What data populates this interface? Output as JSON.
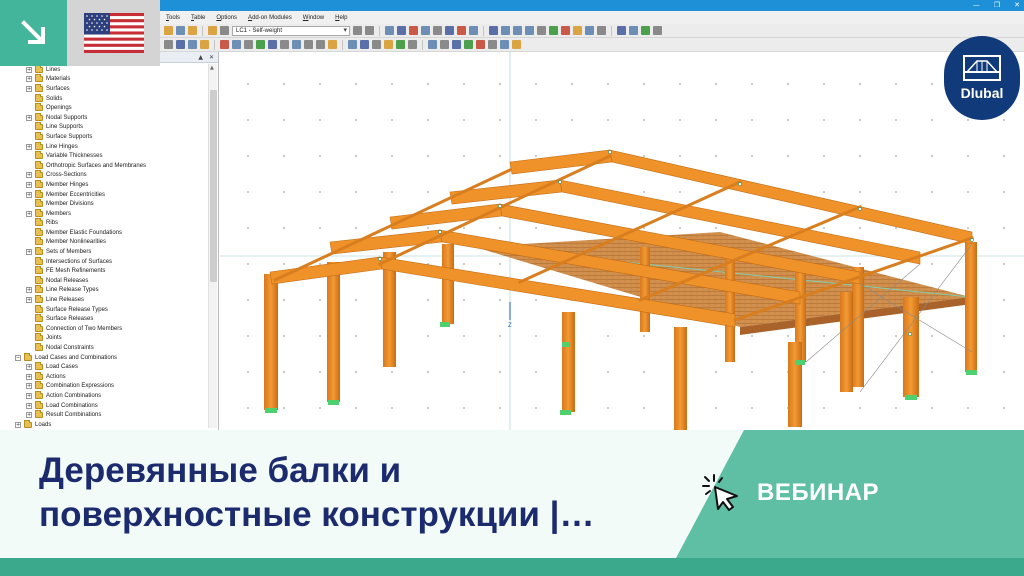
{
  "window": {
    "controls": [
      "—",
      "❐",
      "✕"
    ]
  },
  "menubar": {
    "items": [
      "Tools",
      "Table",
      "Options",
      "Add-on Modules",
      "Window",
      "Help"
    ]
  },
  "toolbar": {
    "load_case": "LC1 - Self-weight"
  },
  "navigator": {
    "header_controls": [
      "▲",
      "✕"
    ],
    "items": [
      {
        "label": "Lines",
        "level": 1,
        "expand": "+"
      },
      {
        "label": "Materials",
        "level": 1,
        "expand": "+"
      },
      {
        "label": "Surfaces",
        "level": 1,
        "expand": "+"
      },
      {
        "label": "Solids",
        "level": 1,
        "expand": ""
      },
      {
        "label": "Openings",
        "level": 1,
        "expand": ""
      },
      {
        "label": "Nodal Supports",
        "level": 1,
        "expand": "+"
      },
      {
        "label": "Line Supports",
        "level": 1,
        "expand": ""
      },
      {
        "label": "Surface Supports",
        "level": 1,
        "expand": ""
      },
      {
        "label": "Line Hinges",
        "level": 1,
        "expand": "+"
      },
      {
        "label": "Variable Thicknesses",
        "level": 1,
        "expand": ""
      },
      {
        "label": "Orthotropic Surfaces and Membranes",
        "level": 1,
        "expand": ""
      },
      {
        "label": "Cross-Sections",
        "level": 1,
        "expand": "+"
      },
      {
        "label": "Member Hinges",
        "level": 1,
        "expand": "+"
      },
      {
        "label": "Member Eccentricities",
        "level": 1,
        "expand": "+"
      },
      {
        "label": "Member Divisions",
        "level": 1,
        "expand": ""
      },
      {
        "label": "Members",
        "level": 1,
        "expand": "+"
      },
      {
        "label": "Ribs",
        "level": 1,
        "expand": ""
      },
      {
        "label": "Member Elastic Foundations",
        "level": 1,
        "expand": ""
      },
      {
        "label": "Member Nonlinearities",
        "level": 1,
        "expand": ""
      },
      {
        "label": "Sets of Members",
        "level": 1,
        "expand": "+"
      },
      {
        "label": "Intersections of Surfaces",
        "level": 1,
        "expand": ""
      },
      {
        "label": "FE Mesh Refinements",
        "level": 1,
        "expand": ""
      },
      {
        "label": "Nodal Releases",
        "level": 1,
        "expand": ""
      },
      {
        "label": "Line Release Types",
        "level": 1,
        "expand": "+"
      },
      {
        "label": "Line Releases",
        "level": 1,
        "expand": "+"
      },
      {
        "label": "Surface Release Types",
        "level": 1,
        "expand": ""
      },
      {
        "label": "Surface Releases",
        "level": 1,
        "expand": ""
      },
      {
        "label": "Connection of Two Members",
        "level": 1,
        "expand": ""
      },
      {
        "label": "Joints",
        "level": 1,
        "expand": ""
      },
      {
        "label": "Nodal Constraints",
        "level": 1,
        "expand": ""
      },
      {
        "label": "Load Cases and Combinations",
        "level": 0,
        "expand": "−"
      },
      {
        "label": "Load Cases",
        "level": 1,
        "expand": "+"
      },
      {
        "label": "Actions",
        "level": 1,
        "expand": "+"
      },
      {
        "label": "Combination Expressions",
        "level": 1,
        "expand": "+"
      },
      {
        "label": "Action Combinations",
        "level": 1,
        "expand": "+"
      },
      {
        "label": "Load Combinations",
        "level": 1,
        "expand": "+"
      },
      {
        "label": "Result Combinations",
        "level": 1,
        "expand": "+"
      },
      {
        "label": "Loads",
        "level": 0,
        "expand": "+"
      }
    ]
  },
  "viewport": {
    "axis_label": "Z"
  },
  "logo": {
    "text": "Dlubal"
  },
  "banner": {
    "title_line1": "Деревянные балки и",
    "title_line2": "поверхностные конструкции |…",
    "tag": "ВЕБИНАР"
  },
  "colors": {
    "accent_green": "#5fbfa4",
    "dark_green": "#3aa98c",
    "title_blue": "#1b2b6e",
    "timber_orange": "#f0922a",
    "logo_blue": "#113a7a"
  }
}
